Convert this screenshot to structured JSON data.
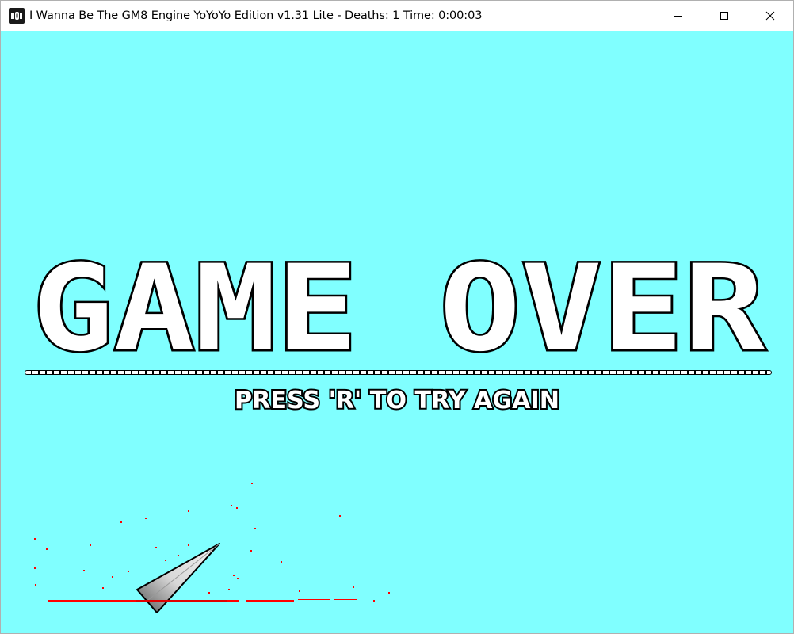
{
  "window": {
    "title": "I Wanna Be The GM8 Engine YoYoYo Edition v1.31 Lite - Deaths: 1 Time: 0:00:03",
    "app_icon": "yoyo-icon",
    "controls": {
      "minimize_icon": "minimize-icon",
      "maximize_icon": "maximize-icon",
      "close_icon": "close-icon"
    }
  },
  "game": {
    "background_color": "#80ffff",
    "game_over_text": "GAME OVER",
    "retry_prompt": "PRESS 'R' TO TRY AGAIN",
    "spike_icon": "spike-icon",
    "blood_color": "#ff0000"
  }
}
